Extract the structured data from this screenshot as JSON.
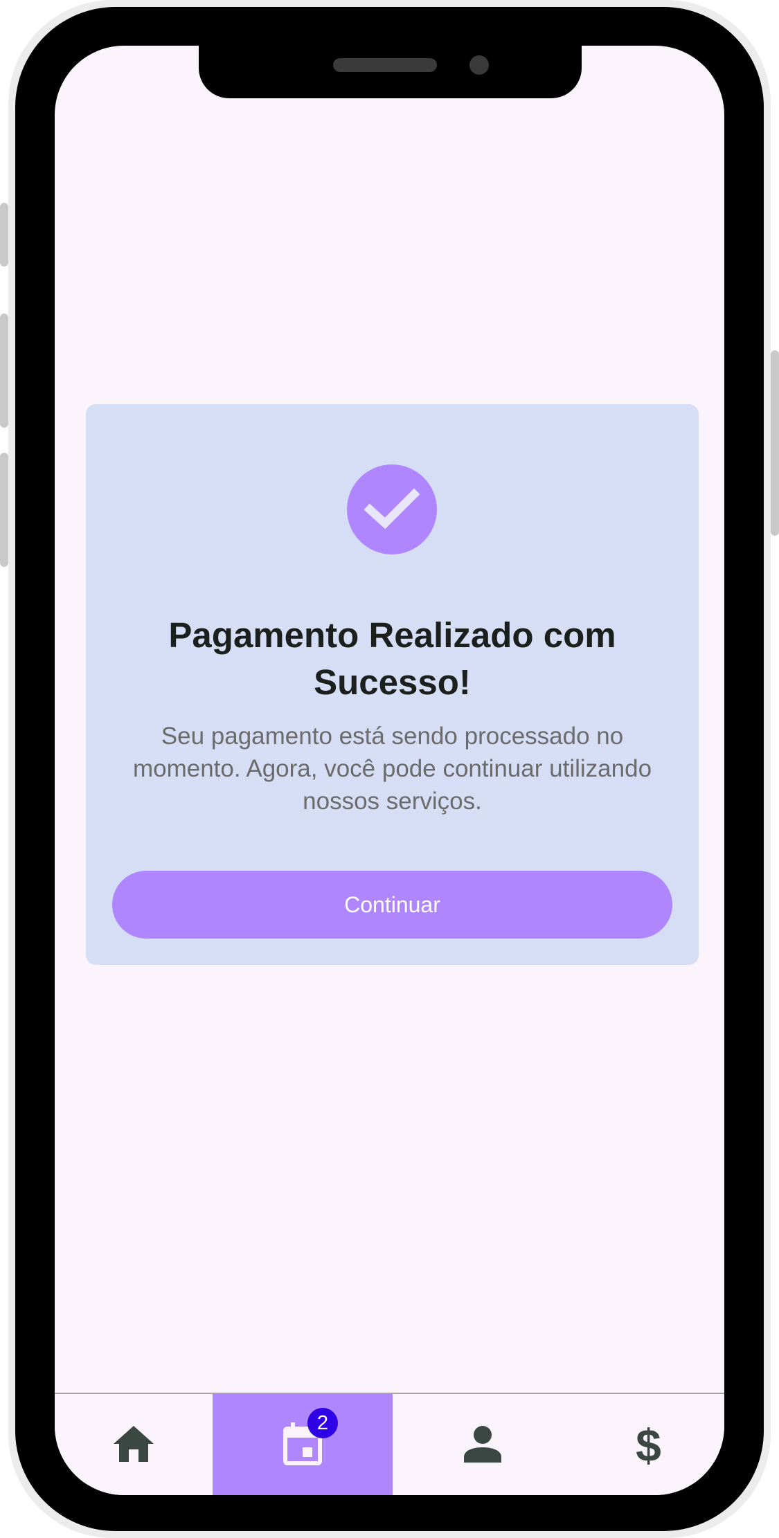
{
  "colors": {
    "screen_background": "#fcf4fc",
    "card_background": "#d5def4",
    "accent": "#b086fe",
    "badge": "#2e00e6",
    "title_text": "#1b1f1d",
    "body_text": "#6b6b6b",
    "nav_icon": "#3b4742"
  },
  "success_card": {
    "icon": "checkmark-icon",
    "title": "Pagamento Realizado com Sucesso!",
    "message": "Seu pagamento está sendo processado no momento. Agora, você pode continuar utilizando nossos serviços.",
    "continue_label": "Continuar"
  },
  "bottom_nav": {
    "items": [
      {
        "icon": "home-icon",
        "active": false
      },
      {
        "icon": "calendar-icon",
        "active": true,
        "badge": "2"
      },
      {
        "icon": "person-icon",
        "active": false
      },
      {
        "icon": "dollar-icon",
        "active": false,
        "glyph": "$"
      }
    ]
  }
}
